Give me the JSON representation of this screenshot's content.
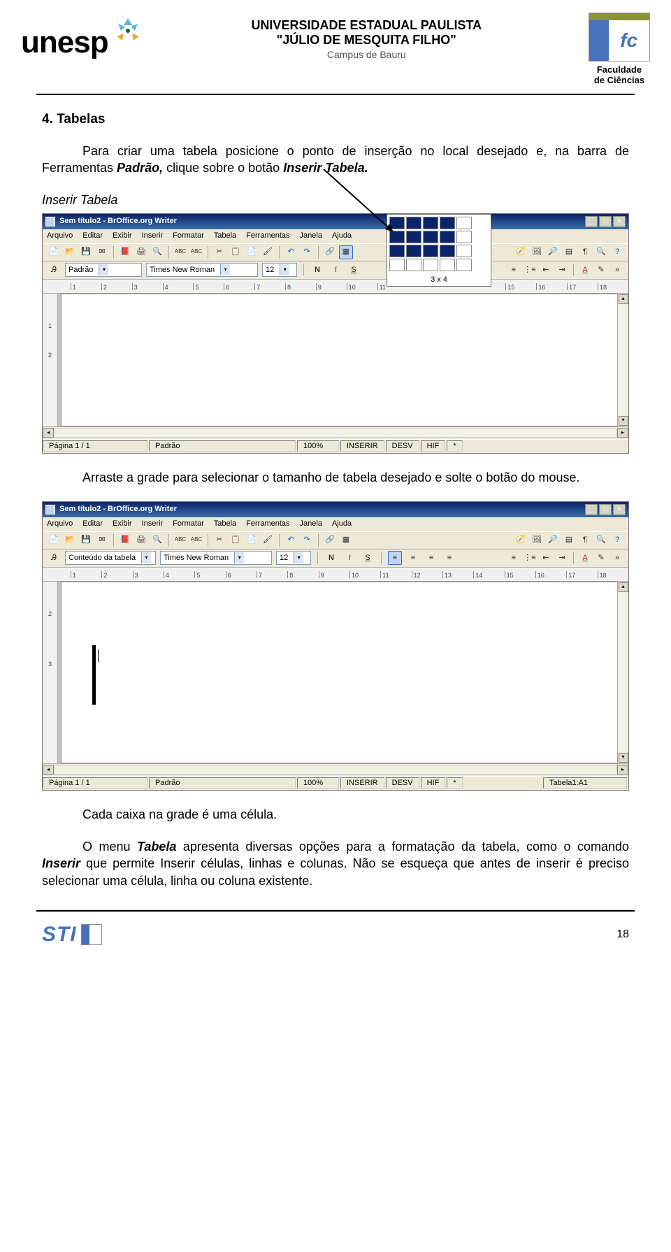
{
  "header": {
    "unesp": "unesp",
    "uni_line1": "UNIVERSIDADE ESTADUAL PAULISTA",
    "uni_line2": "\"JÚLIO DE MESQUITA FILHO\"",
    "uni_line3": "Campus de Bauru",
    "fc_line1": "Faculdade",
    "fc_line2": "de Ciências"
  },
  "section_title": "4.   Tabelas",
  "para1_pre": "Para criar uma tabela posicione o ponto de inserção no local desejado e, na barra de Ferramentas ",
  "para1_bi1": "Padrão,",
  "para1_mid": " clique sobre o botão ",
  "para1_bi2": "Inserir Tabela.",
  "callout1": "Inserir Tabela",
  "para2": "Arraste a grade para selecionar o tamanho de tabela desejado e solte o botão do mouse.",
  "para3_pre": "Cada caixa na grade é uma célula.",
  "para4_a": "O menu ",
  "para4_b": "Tabela",
  "para4_c": " apresenta diversas opções para a formatação da tabela, como o comando ",
  "para4_d": "Inserir",
  "para4_e": " que permite Inserir células, linhas e colunas. Não se esqueça que antes de inserir é preciso selecionar uma célula, linha ou coluna existente.",
  "page_number": "18",
  "screenshot": {
    "title": "Sem título2 - BrOffice.org Writer",
    "menus": [
      "Arquivo",
      "Editar",
      "Exibir",
      "Inserir",
      "Formatar",
      "Tabela",
      "Ferramentas",
      "Janela",
      "Ajuda"
    ],
    "style1": "Padrão",
    "style2": "Conteúdo da tabela",
    "font": "Times New Roman",
    "size": "12",
    "grid_label": "3 x 4",
    "ruler_ticks": [
      "1",
      "2",
      "3",
      "4",
      "5",
      "6",
      "7",
      "8",
      "9",
      "10",
      "11",
      "12",
      "13",
      "14",
      "15",
      "16",
      "17",
      "18"
    ],
    "ruler_ticks_short": [
      "1",
      "2",
      "3",
      "4",
      "5",
      "6",
      "7",
      "8",
      "9",
      "10",
      "11"
    ],
    "vruler": [
      "1",
      "2"
    ],
    "vruler2": [
      "2",
      "3"
    ],
    "status": {
      "page": "Página 1 / 1",
      "style": "Padrão",
      "zoom": "100%",
      "ins": "INSERIR",
      "desv": "DESV",
      "hif": "HIF",
      "star": "*",
      "tbl": "Tabela1:A1"
    }
  },
  "footer": {
    "sti": "STI"
  }
}
